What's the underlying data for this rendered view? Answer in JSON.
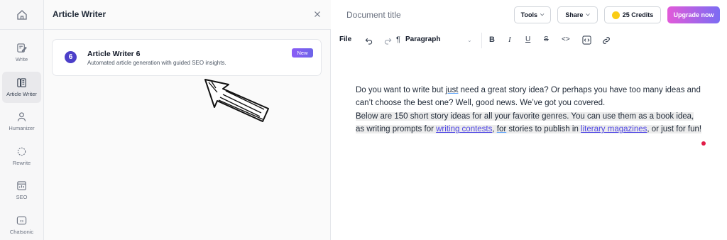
{
  "rail": {
    "items": [
      {
        "label": "Write",
        "icon": "write-icon"
      },
      {
        "label": "Article Writer",
        "icon": "article-writer-icon",
        "active": true
      },
      {
        "label": "Humanizer",
        "icon": "humanizer-icon"
      },
      {
        "label": "Rewrite",
        "icon": "rewrite-icon"
      },
      {
        "label": "SEO",
        "icon": "seo-icon"
      },
      {
        "label": "Chatsonic",
        "icon": "chatsonic-icon",
        "badge": "cs"
      }
    ]
  },
  "panel": {
    "title": "Article Writer",
    "card": {
      "number": "6",
      "title": "Article Writer 6",
      "description": "Automated article generation with guided SEO insights.",
      "badge": "New"
    }
  },
  "editor": {
    "document_title": "Document title",
    "tools_label": "Tools",
    "share_label": "Share",
    "credits_label": "25 Credits",
    "upgrade_label": "Upgrade now",
    "toolbar": {
      "file": "File",
      "paragraph": "Paragraph",
      "buttons": [
        "undo",
        "redo",
        "bold",
        "italic",
        "underline",
        "strikethrough",
        "code",
        "code-block",
        "link"
      ]
    },
    "content": {
      "p1_a": "Do you want to write but ",
      "p1_just": "just",
      "p1_b": " need a great story idea? Or perhaps you have too many ideas and can’t choose the best one? Well, good news. We’ve got you covered.",
      "p2_a": "Below are 150 short story ideas for all your favorite genres. You can use them as a book idea, as writing prompts for ",
      "p2_link1": "writing contests",
      "p2_b": ", ",
      "p2_for": "for",
      "p2_c": " stories to publish in ",
      "p2_link2": "literary magazines",
      "p2_d": ", or just for fun!"
    }
  },
  "colors": {
    "accent": "#4c3fc9",
    "link": "#4f46e5",
    "badge_gradient": [
      "#8b5cf6",
      "#6d64e8"
    ],
    "upgrade_gradient": [
      "#e25ad9",
      "#7b6cf3"
    ]
  }
}
